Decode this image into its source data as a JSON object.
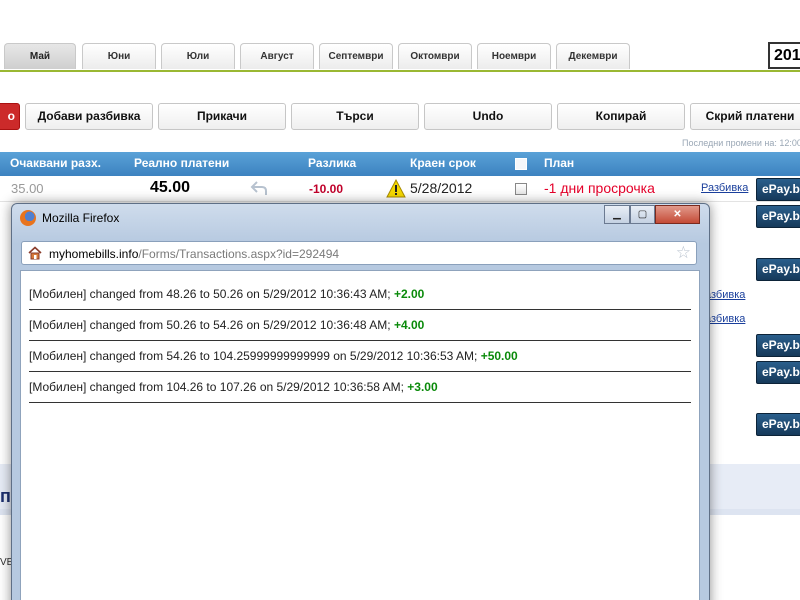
{
  "months": [
    "Май",
    "Юни",
    "Юли",
    "Август",
    "Септември",
    "Октомври",
    "Ноември",
    "Декември"
  ],
  "active_month": "Май",
  "year_fragment": "201",
  "toolbar": {
    "buttons": [
      "о",
      "Добави разбивка",
      "Прикачи",
      "Търси",
      "Undo",
      "Копирай",
      "Скрий платени"
    ],
    "last_changed": "Последни промени на: 12:00"
  },
  "table": {
    "headers": [
      "Очаквани разх.",
      "Реално платени",
      "Разлика",
      "Краен срок",
      "План"
    ],
    "row": {
      "expected": "35.00",
      "paid": "45.00",
      "difference": "-10.00",
      "due_date": "5/28/2012",
      "status": "-1 дни просрочка",
      "link": "Разбивка"
    },
    "epay_label": "ePay.bg",
    "side_links": [
      "азбивка",
      "азбивка"
    ]
  },
  "bottom": {
    "fragment_1": "пі",
    "fragment_2": "VEx"
  },
  "firefox": {
    "title": "Mozilla Firefox",
    "url_host": "myhomebills.info",
    "url_path": "/Forms/Transactions.aspx?id=292494",
    "entries": [
      {
        "text": "[Мобилен] changed from 48.26 to 50.26 on 5/29/2012 10:36:43 AM;",
        "delta": "+2.00"
      },
      {
        "text": "[Мобилен] changed from 50.26 to 54.26 on 5/29/2012 10:36:48 AM;",
        "delta": "+4.00"
      },
      {
        "text": "[Мобилен] changed from 54.26 to 104.25999999999999 on 5/29/2012 10:36:53 AM;",
        "delta": "+50.00"
      },
      {
        "text": "[Мобилен] changed from 104.26 to 107.26 on 5/29/2012 10:36:58 AM;",
        "delta": "+3.00"
      }
    ]
  },
  "colors": {
    "header_blue": "#3c82c0",
    "accent_green": "#9ab832",
    "negative_red": "#c0002a",
    "overdue_red": "#e5002a",
    "delta_green": "#0a8a0a",
    "epay_navy": "#16395a"
  }
}
